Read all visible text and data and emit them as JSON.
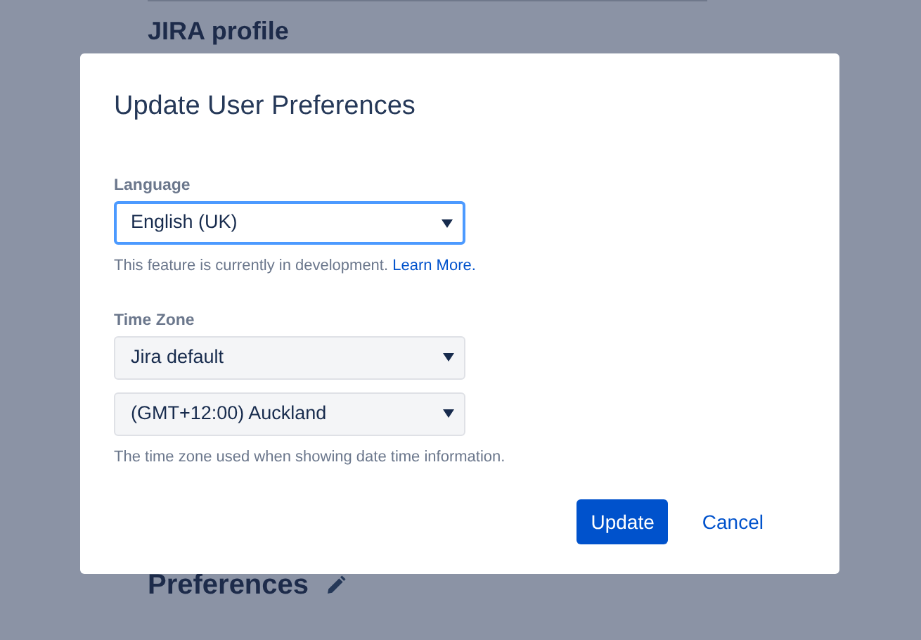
{
  "background": {
    "heading": "JIRA profile",
    "section_heading": "Preferences"
  },
  "dialog": {
    "title": "Update User Preferences",
    "fields": [
      {
        "label": "Language",
        "selects": [
          {
            "value": "English (UK)",
            "focused": true
          }
        ],
        "help": "This feature is currently in development.",
        "help_link": "Learn More."
      },
      {
        "label": "Time Zone",
        "selects": [
          {
            "value": "Jira default",
            "focused": false
          },
          {
            "value": "(GMT+12:00) Auckland",
            "focused": false
          }
        ],
        "help": "The time zone used when showing date time information."
      }
    ],
    "buttons": [
      {
        "label": "Update",
        "kind": "primary"
      },
      {
        "label": "Cancel",
        "kind": "link"
      }
    ]
  }
}
